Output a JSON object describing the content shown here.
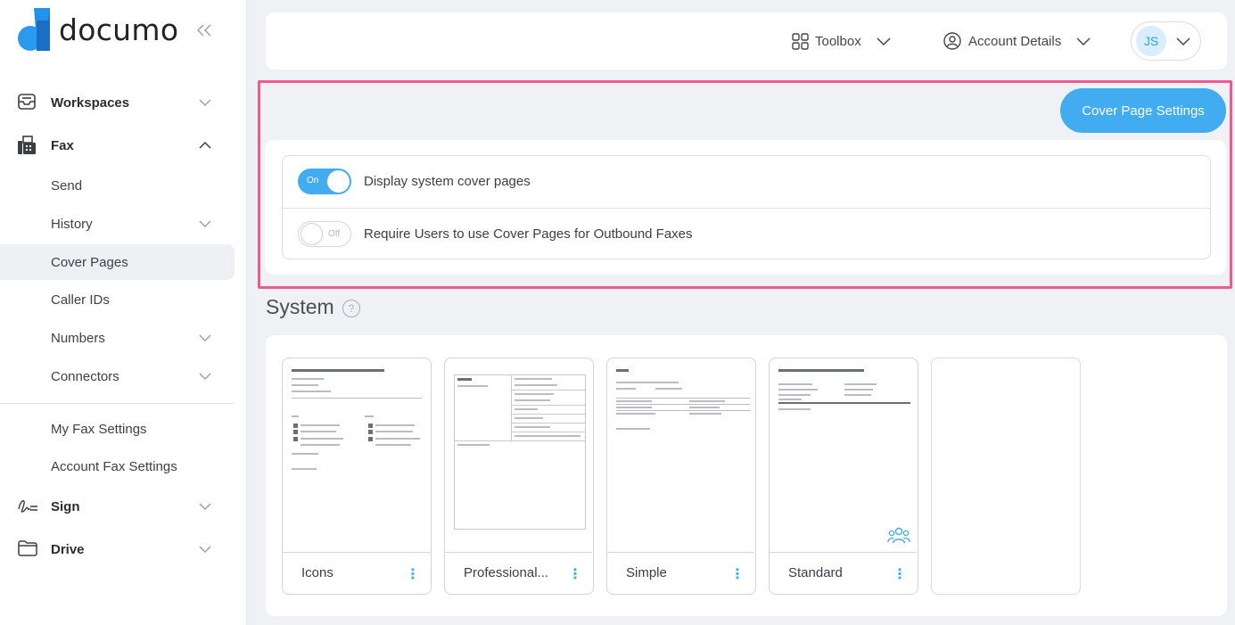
{
  "brand": {
    "name": "documo",
    "accent": "#42acf1",
    "highlight": "#ee5b8c"
  },
  "sidebar": {
    "collapse_icon": "double-chevron-left-icon",
    "items": [
      {
        "label": "Workspaces",
        "icon": "inbox-tray-icon",
        "type": "main",
        "expanded": false
      },
      {
        "label": "Fax",
        "icon": "fax-machine-icon",
        "type": "main",
        "expanded": true
      },
      {
        "label": "Send",
        "type": "sub"
      },
      {
        "label": "History",
        "type": "sub",
        "has_children": true
      },
      {
        "label": "Cover Pages",
        "type": "sub",
        "active": true
      },
      {
        "label": "Caller IDs",
        "type": "sub"
      },
      {
        "label": "Numbers",
        "type": "sub",
        "has_children": true
      },
      {
        "label": "Connectors",
        "type": "sub",
        "has_children": true
      },
      {
        "label": "My Fax Settings",
        "type": "sub"
      },
      {
        "label": "Account Fax Settings",
        "type": "sub"
      },
      {
        "label": "Sign",
        "icon": "signature-icon",
        "type": "main",
        "expanded": false
      },
      {
        "label": "Drive",
        "icon": "folder-icon",
        "type": "main",
        "expanded": false
      }
    ]
  },
  "header": {
    "toolbox_label": "Toolbox",
    "account_label": "Account Details",
    "avatar_initials": "JS"
  },
  "cover_settings": {
    "button_label": "Cover Page Settings",
    "options": [
      {
        "label": "Display system cover pages",
        "state": "On"
      },
      {
        "label": "Require Users to use Cover Pages for Outbound Faxes",
        "state": "Off"
      }
    ]
  },
  "system": {
    "title": "System",
    "help_glyph": "?",
    "templates": [
      {
        "name": "Icons",
        "style": "icons"
      },
      {
        "name": "Professional...",
        "style": "professional"
      },
      {
        "name": "Simple",
        "style": "simple"
      },
      {
        "name": "Standard",
        "style": "standard",
        "badge_icon": "users-group-icon"
      },
      {
        "name": "",
        "style": "blank"
      }
    ],
    "menu_glyph": "⋮"
  }
}
